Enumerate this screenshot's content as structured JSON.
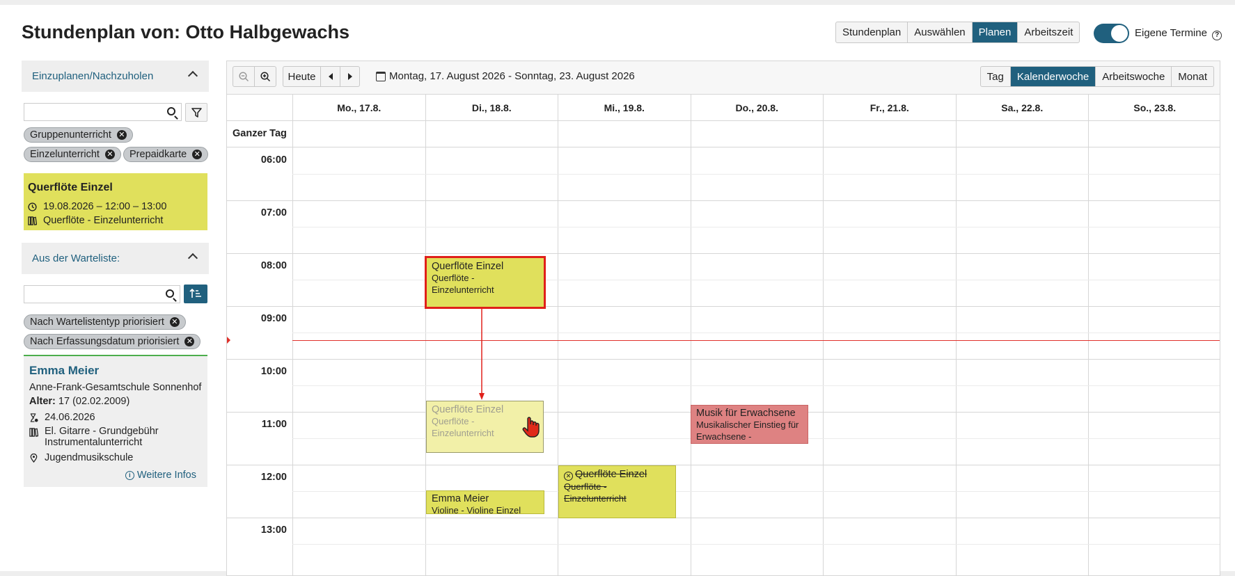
{
  "page": {
    "title": "Stundenplan von: Otto Halbgewachs"
  },
  "modes": [
    "Stundenplan",
    "Auswählen",
    "Planen",
    "Arbeitszeit"
  ],
  "active_mode": "Planen",
  "own_events_toggle": {
    "label": "Eigene Termine",
    "on": true,
    "help": "?"
  },
  "sidebar": {
    "section1": {
      "title": "Einzuplanen/Nachzuholen",
      "search_value": "",
      "chips": [
        "Gruppenunterricht",
        "Einzelunterricht",
        "Prepaidkarte"
      ],
      "card": {
        "title": "Querflöte Einzel",
        "time": "19.08.2026 – 12:00 – 13:00",
        "course": "Querflöte - Einzelunterricht"
      }
    },
    "section2": {
      "title": "Aus der Warteliste:",
      "search_value": "",
      "chips": [
        "Nach Wartelistentyp priorisiert",
        "Nach Erfassungsdatum priorisiert"
      ],
      "card": {
        "name": "Emma Meier",
        "school": "Anne-Frank-Gesamtschule Sonnenhof",
        "age_label": "Alter:",
        "age_value": "17 (02.02.2009)",
        "date": "24.06.2026",
        "course_line1": "El. Gitarre - Grundgebühr",
        "course_line2": "Instrumentalunterricht",
        "location": "Jugendmusikschule",
        "more": "Weitere Infos"
      }
    }
  },
  "calendar": {
    "today_label": "Heute",
    "date_range": "Montag, 17. August 2026 - Sonntag, 23. August 2026",
    "views": [
      "Tag",
      "Kalenderwoche",
      "Arbeitswoche",
      "Monat"
    ],
    "active_view": "Kalenderwoche",
    "days": [
      "Mo., 17.8.",
      "Di., 18.8.",
      "Mi., 19.8.",
      "Do., 20.8.",
      "Fr., 21.8.",
      "Sa., 22.8.",
      "So., 23.8."
    ],
    "all_day_label": "Ganzer Tag",
    "hours": [
      "06:00",
      "07:00",
      "08:00",
      "09:00",
      "10:00",
      "11:00",
      "12:00",
      "13:00"
    ],
    "events": {
      "selected": {
        "title": "Querflöte Einzel",
        "sub1": "Querflöte -",
        "sub2": "Einzelunterricht"
      },
      "ghost": {
        "title": "Querflöte Einzel",
        "sub1": "Querflöte -",
        "sub2": "Einzelunterricht"
      },
      "emma": {
        "title": "Emma Meier",
        "sub1": "Violine - Violine Einzel"
      },
      "cancelled": {
        "title": "Querflöte Einzel",
        "sub1": "Querflöte -",
        "sub2": "Einzelunterricht"
      },
      "adults": {
        "title": "Musik für Erwachsene",
        "sub1": "Musikalischer Einstieg für",
        "sub2": "Erwachsene -"
      }
    }
  },
  "colors": {
    "accent": "#20607e",
    "event_yellow": "#e0e05c",
    "event_red": "#de8282",
    "now_line": "#e0302a"
  }
}
